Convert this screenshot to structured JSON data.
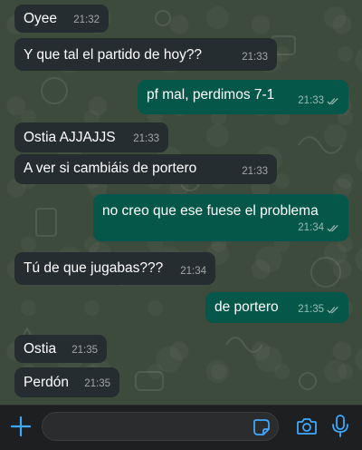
{
  "colors": {
    "incoming_bubble": "#262d31",
    "outgoing_bubble": "#05574a",
    "accent": "#3fa9ff",
    "read_ticks": "#9fb8b0"
  },
  "messages": [
    {
      "direction": "in",
      "text": "Oyee",
      "time": "21:32"
    },
    {
      "direction": "in",
      "text": "Y que tal el partido de hoy??",
      "time": "21:33"
    },
    {
      "direction": "out",
      "text": "pf mal, perdimos 7-1",
      "time": "21:33",
      "status": "read"
    },
    {
      "direction": "in",
      "text": "Ostia AJJAJJS",
      "time": "21:33"
    },
    {
      "direction": "in",
      "text": "A ver si cambiáis de portero",
      "time": "21:33"
    },
    {
      "direction": "out",
      "text": "no creo que ese fuese el problema",
      "time": "21:34",
      "status": "read"
    },
    {
      "direction": "in",
      "text": "Tú de que jugabas???",
      "time": "21:34"
    },
    {
      "direction": "out",
      "text": "de portero",
      "time": "21:35",
      "status": "read"
    },
    {
      "direction": "in",
      "text": "Ostia",
      "time": "21:35"
    },
    {
      "direction": "in",
      "text": "Perdón",
      "time": "21:35"
    }
  ],
  "input_bar": {
    "message_value": "",
    "placeholder": "",
    "icons": [
      "plus-icon",
      "sticker-icon",
      "camera-icon",
      "microphone-icon"
    ]
  }
}
